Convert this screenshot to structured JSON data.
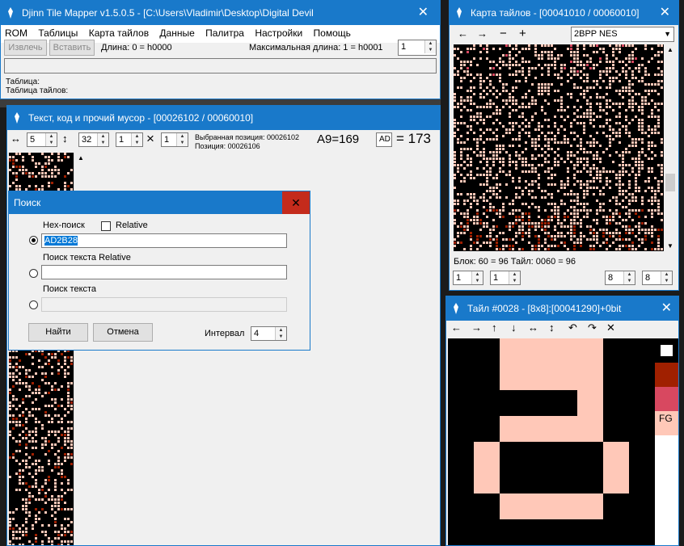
{
  "main_window": {
    "title": "Djinn Tile Mapper v1.5.0.5 - [C:\\Users\\Vladimir\\Desktop\\Digital Devil",
    "menu": [
      "ROM",
      "Таблицы",
      "Карта тайлов",
      "Данные",
      "Палитра",
      "Настройки",
      "Помощь"
    ],
    "btn_extract": "Извлечь",
    "btn_insert": "Вставить",
    "length_label": "Длина: 0 = h0000",
    "max_length_label": "Максимальная длина: 1 = h0001",
    "max_length_value": "1",
    "table_label": "Таблица:",
    "tile_table_label": "Таблица тайлов:"
  },
  "text_window": {
    "title": "Текст, код и прочий мусор - [00026102 / 00060010]",
    "spin1": "5",
    "spin2": "32",
    "spin3": "1",
    "spin4": "1",
    "times": "×",
    "selected_pos": "Выбранная позиция: 00026102",
    "pos": "Позиция: 00026106",
    "hex_expr": "A9=169",
    "ad_box": "AD",
    "eq_expr": "= 173"
  },
  "search_dialog": {
    "title": "Поиск",
    "hex_search_label": "Hex-поиск",
    "relative_label": "Relative",
    "hex_value": "AD2B28",
    "rel_text_label": "Поиск текста Relative",
    "text_search_label": "Поиск текста",
    "find_button": "Найти",
    "cancel_button": "Отмена",
    "interval_label": "Интервал",
    "interval_value": "4"
  },
  "tilemap_window": {
    "title": "Карта тайлов - [00041010 / 00060010]",
    "tools": [
      "←",
      "→",
      "−",
      "+"
    ],
    "format": "2BPP NES",
    "block_label": "Блок: 60 = 96  Тайл: 0060 = 96",
    "spins": [
      "1",
      "1",
      "8",
      "8"
    ]
  },
  "tile_window": {
    "title": "Тайл #0028 - [8x8]:[00041290]+0bit",
    "tools": [
      "←",
      "→",
      "↑",
      "↓",
      "↔",
      "↕",
      "↶",
      "↷",
      "✕"
    ],
    "palette_fg_label": "FG",
    "colors": {
      "black": "#000000",
      "pink": "#ffc8b8",
      "brown": "#a02000",
      "red": "#d84860",
      "white": "#ffffff",
      "accent": "#1979ca"
    }
  }
}
